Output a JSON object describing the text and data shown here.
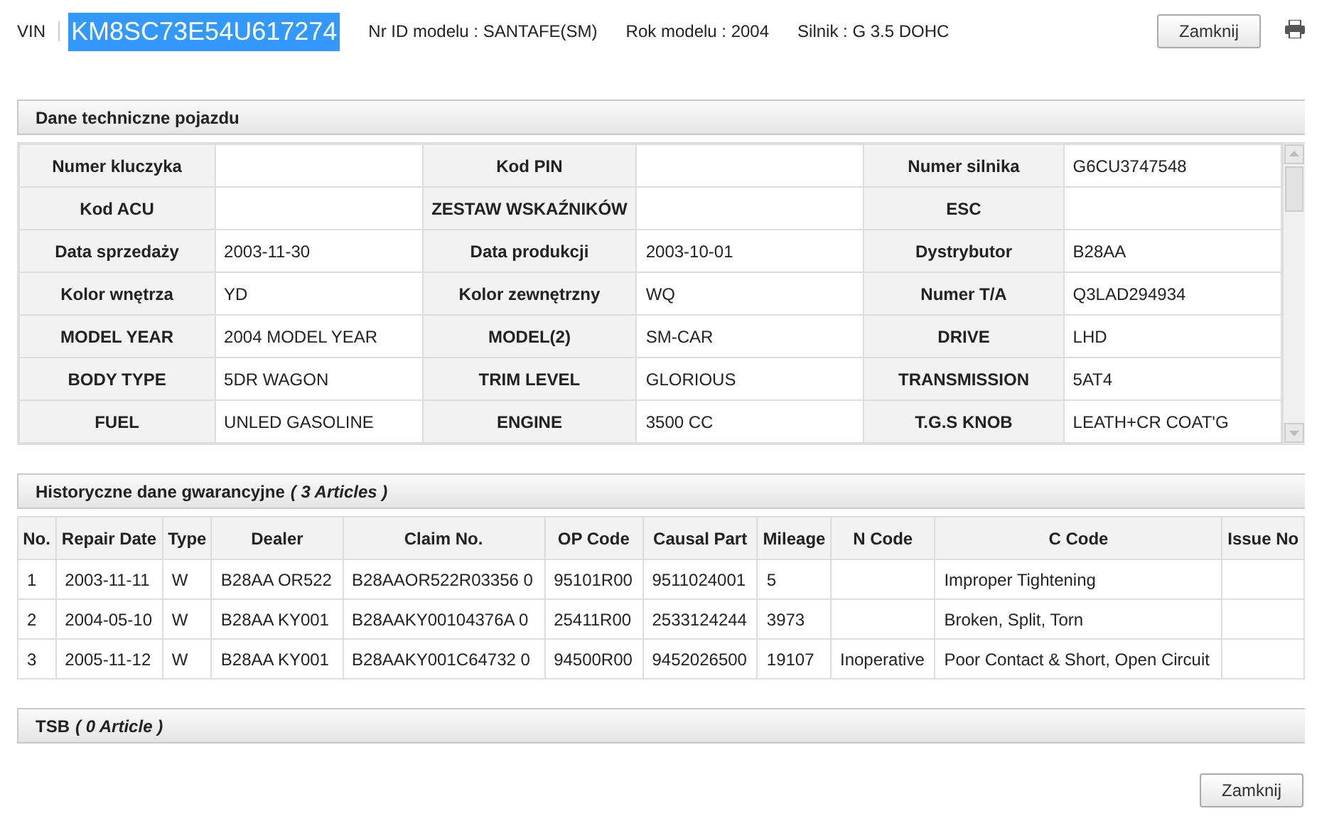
{
  "header": {
    "vin_label": "VIN",
    "vin": {
      "text": "KM8SC73E54U617274",
      "selected": true
    },
    "info": [
      "Nr ID modelu : SANTAFE(SM)",
      "Rok modelu : 2004",
      "Silnik : G 3.5 DOHC"
    ],
    "close_button": "Zamknij"
  },
  "specs": {
    "title": "Dane techniczne pojazdu",
    "rows": [
      [
        {
          "label": "Numer kluczyka"
        },
        {
          "label": "Kod PIN"
        },
        {
          "label": "Numer silnika",
          "value": "G6CU3747548"
        }
      ],
      [
        {
          "label": "Kod ACU"
        },
        {
          "label": "ZESTAW WSKAŹNIKÓW"
        },
        {
          "label": "ESC"
        }
      ],
      [
        {
          "label": "Data sprzedaży",
          "value": "2003-11-30"
        },
        {
          "label": "Data produkcji",
          "value": "2003-10-01"
        },
        {
          "label": "Dystrybutor",
          "value": "B28AA"
        }
      ],
      [
        {
          "label": "Kolor wnętrza",
          "value": "YD"
        },
        {
          "label": "Kolor zewnętrzny",
          "value": "WQ"
        },
        {
          "label": "Numer T/A",
          "value": "Q3LAD294934"
        }
      ],
      [
        {
          "label": "MODEL YEAR",
          "value": "2004 MODEL YEAR"
        },
        {
          "label": "MODEL(2)",
          "value": "SM-CAR"
        },
        {
          "label": "DRIVE",
          "value": "LHD"
        }
      ],
      [
        {
          "label": "BODY TYPE",
          "value": "5DR WAGON"
        },
        {
          "label": "TRIM LEVEL",
          "value": "GLORIOUS"
        },
        {
          "label": "TRANSMISSION",
          "value": "5AT4"
        }
      ],
      [
        {
          "label": "FUEL",
          "value": "UNLED GASOLINE"
        },
        {
          "label": "ENGINE",
          "value": "3500 CC"
        },
        {
          "label": "T.G.S KNOB",
          "value": "LEATH+CR COAT'G"
        }
      ]
    ]
  },
  "warranty": {
    "title": "Historyczne dane gwarancyjne",
    "count": "( 3 Articles )",
    "columns": [
      "No.",
      "Repair Date",
      "Type",
      "Dealer",
      "Claim No.",
      "OP Code",
      "Causal Part",
      "Mileage",
      "N Code",
      "C Code",
      "Issue No"
    ],
    "rows": [
      [
        "1",
        "2003-11-11",
        "W",
        "B28AA OR522",
        "B28AAOR522R03356 0",
        "95101R00",
        "9511024001",
        "5",
        "",
        "Improper Tightening",
        ""
      ],
      [
        "2",
        "2004-05-10",
        "W",
        "B28AA KY001",
        "B28AAKY00104376A 0",
        "25411R00",
        "2533124244",
        "3973",
        "",
        "Broken, Split, Torn",
        ""
      ],
      [
        "3",
        "2005-11-12",
        "W",
        "B28AA KY001",
        "B28AAKY001C64732 0",
        "94500R00",
        "9452026500",
        "19107",
        "Inoperative",
        "Poor Contact & Short, Open Circuit",
        ""
      ]
    ]
  },
  "tsb": {
    "title": "TSB",
    "count": "( 0 Article )"
  },
  "footer": {
    "close_button": "Zamknij"
  }
}
